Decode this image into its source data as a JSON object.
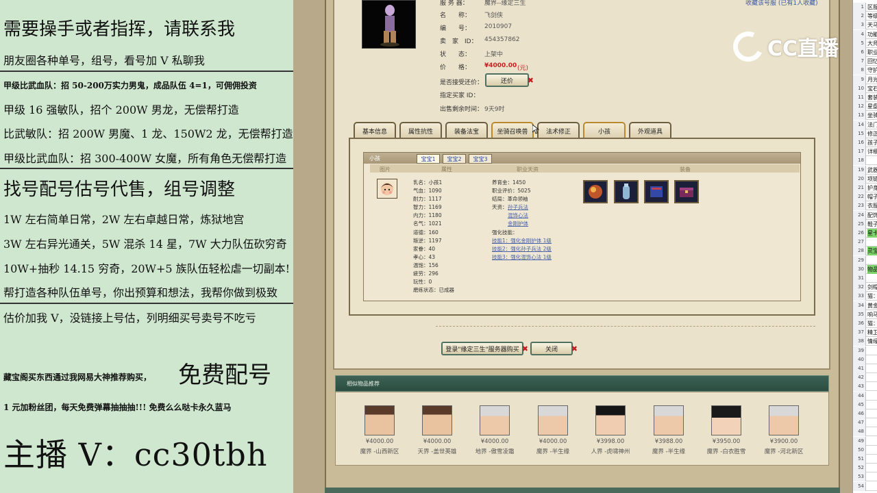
{
  "overlay": {
    "lines": [
      "需要操手或者指挥，请联系我",
      "朋友圈各种单号，组号，看号加 V 私聊我",
      "甲级比武血队：招 50-200万实力男鬼，成品队伍 4=1，可佣佣投资",
      "甲级 16 强敏队，招个 200W 男龙，无偿帮打造",
      "比武敏队：招 200W 男魔、1 龙、150W2 龙，无偿帮打造",
      "甲级比武血队：招 300-400W 女魔，所有角色无偿帮打造",
      "找号配号估号代售，组号调整",
      "1W 左右简单日常，2W 左右卓越日常，炼狱地宫",
      "3W 左右异光通关，5W 混杀 14 星，7W 大力队伍砍穷奇",
      "10W+抽秒 14.15 穷奇，20W+5 族队伍轻松虐一切副本!",
      "帮打造各种队伍单号，你出预算和想法，我帮你做到极致",
      "估价加我 V，没链接上号估，列明细买号卖号不吃亏",
      "藏宝阁买东西通过我网易大神推荐购买，",
      "免费配号",
      "1 元加粉丝团，每天免费弹幕抽抽抽!!! 免费么么哒卡永久蓝马",
      "主播 V：cc30tbh"
    ]
  },
  "trade": {
    "server_label": "服 务 器：",
    "server_value": "魔界--缘定三生",
    "favorite_text": "收藏该号服 (已有1人收藏)",
    "name_label": "名　　称：",
    "name_value": "飞剑侠",
    "id_label": "编　　号：",
    "id_value": "2010907",
    "seller_label": "卖　家　ID：",
    "seller_value": "454357862",
    "status_label": "状　　态：",
    "status_value": "上架中",
    "price_label": "价　　格：",
    "price_value": "¥4000.00",
    "price_unit": "(元)",
    "counter_label": "是否接受还价：",
    "counter_button": "还价",
    "buyer_label": "指定买家 ID：",
    "time_label": "出售剩余时间：",
    "time_value": "9天9时"
  },
  "tabs": [
    "基本信息",
    "属性抗性",
    "装备法宝",
    "坐骑召唤兽",
    "法术修正",
    "小孩",
    "外观道具"
  ],
  "child": {
    "header": "小孩",
    "subtabs": [
      "宝宝1",
      "宝宝2",
      "宝宝3"
    ],
    "columns": [
      "图片",
      "属性",
      "职业天资",
      "装备"
    ],
    "stats_left": [
      "乳名：小孩1",
      "气血：1090",
      "耐力：1117",
      "智力：1169",
      "内力：1180",
      "名气：1021",
      "道德：160",
      "叛逆：1197",
      "家眷：40",
      "孝心：43",
      "温饱：156",
      "疲劳：296",
      "玩性：0",
      "磨练状态：已成器"
    ],
    "stats_right": [
      "养育金：1450",
      "职业评价：5025",
      "结局：革命领袖",
      "天资："
    ],
    "talents": [
      "孙子兵法",
      "混饰心法",
      "金刚护体"
    ],
    "skills_label": "强化技能：",
    "skills": [
      "技能1：强化金刚护体 1级",
      "技能2：强化孙子兵法 2级",
      "技能3：强化混饰心法 1级"
    ]
  },
  "buttons": {
    "login_buy": "登录\"缘定三生\"服务器购买",
    "close": "关闭"
  },
  "recommend": {
    "title": "相似物品推荐",
    "items": [
      {
        "price": "¥4000.00",
        "server": "魔界 -山西新区"
      },
      {
        "price": "¥4000.00",
        "server": "天界 -盖世英雄"
      },
      {
        "price": "¥4000.00",
        "server": "地界 -傲雪凌霜"
      },
      {
        "price": "¥4000.00",
        "server": "魔界 -半生缘"
      },
      {
        "price": "¥3998.00",
        "server": "人界 -虎啸神州"
      },
      {
        "price": "¥3988.00",
        "server": "魔界 -半生缘"
      },
      {
        "price": "¥3950.00",
        "server": "魔界 -白衣胜雪"
      },
      {
        "price": "¥3900.00",
        "server": "魔界 -河北新区"
      }
    ]
  },
  "logo": {
    "text": "CC直播"
  },
  "sheet": {
    "rows": [
      {
        "n": "1",
        "c": "区服"
      },
      {
        "n": "2",
        "c": "等级"
      },
      {
        "n": "3",
        "c": "天马"
      },
      {
        "n": "4",
        "c": "功能"
      },
      {
        "n": "5",
        "c": "大师"
      },
      {
        "n": "6",
        "c": "职业"
      },
      {
        "n": "7",
        "c": "回忆"
      },
      {
        "n": "8",
        "c": "守护"
      },
      {
        "n": "9",
        "c": "月光"
      },
      {
        "n": "10",
        "c": "宝石"
      },
      {
        "n": "11",
        "c": "套装"
      },
      {
        "n": "12",
        "c": "星盘"
      },
      {
        "n": "13",
        "c": "坐骑"
      },
      {
        "n": "14",
        "c": "法门"
      },
      {
        "n": "15",
        "c": "修正"
      },
      {
        "n": "16",
        "c": "孩子"
      },
      {
        "n": "17",
        "c": "详细"
      },
      {
        "n": "18",
        "c": ""
      },
      {
        "n": "19",
        "c": "武器"
      },
      {
        "n": "20",
        "c": "项链"
      },
      {
        "n": "21",
        "c": "护身"
      },
      {
        "n": "22",
        "c": "帽子"
      },
      {
        "n": "23",
        "c": "衣服"
      },
      {
        "n": "24",
        "c": "配饰"
      },
      {
        "n": "25",
        "c": "鞋子"
      },
      {
        "n": "26",
        "c": "星卡"
      },
      {
        "n": "27",
        "c": ""
      },
      {
        "n": "28",
        "c": "灵宝"
      },
      {
        "n": "29",
        "c": ""
      },
      {
        "n": "30",
        "c": "物品"
      },
      {
        "n": "31",
        "c": ""
      },
      {
        "n": "32",
        "c": "剑帽"
      },
      {
        "n": "33",
        "c": "猫："
      },
      {
        "n": "34",
        "c": "黄金"
      },
      {
        "n": "35",
        "c": "响马"
      },
      {
        "n": "36",
        "c": "猫："
      },
      {
        "n": "37",
        "c": "精卫"
      },
      {
        "n": "38",
        "c": "情缘"
      },
      {
        "n": "39",
        "c": ""
      },
      {
        "n": "40",
        "c": ""
      },
      {
        "n": "41",
        "c": ""
      },
      {
        "n": "42",
        "c": ""
      },
      {
        "n": "43",
        "c": ""
      },
      {
        "n": "44",
        "c": ""
      },
      {
        "n": "45",
        "c": ""
      },
      {
        "n": "46",
        "c": ""
      },
      {
        "n": "47",
        "c": ""
      },
      {
        "n": "48",
        "c": ""
      },
      {
        "n": "49",
        "c": ""
      },
      {
        "n": "50",
        "c": ""
      },
      {
        "n": "51",
        "c": ""
      },
      {
        "n": "52",
        "c": ""
      },
      {
        "n": "53",
        "c": ""
      },
      {
        "n": "54",
        "c": ""
      }
    ]
  }
}
